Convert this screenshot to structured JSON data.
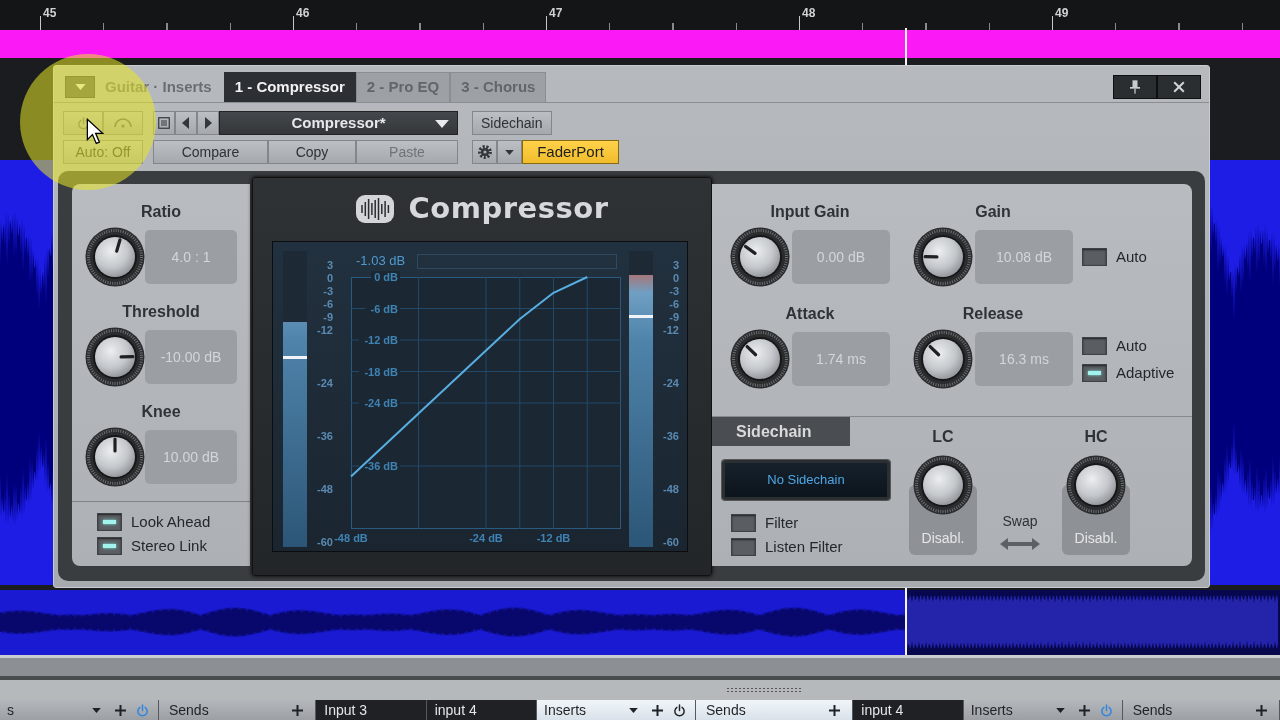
{
  "timeline": {
    "bars": [
      "45",
      "46",
      "47",
      "48",
      "49"
    ]
  },
  "plugin": {
    "title": "Guitar · Inserts",
    "tabs": [
      {
        "label": "1 - Compressor",
        "selected": true
      },
      {
        "label": "2 - Pro EQ",
        "selected": false
      },
      {
        "label": "3 - Chorus",
        "selected": false
      }
    ],
    "preset": "Compressor*",
    "sidechain_button": "Sidechain",
    "automation_button": "Auto: Off",
    "edit_buttons": [
      {
        "label": "Compare",
        "disabled": false
      },
      {
        "label": "Copy",
        "disabled": false
      },
      {
        "label": "Paste",
        "disabled": true
      }
    ],
    "device_button": {
      "label": "FaderPort",
      "active": true
    }
  },
  "compressor": {
    "title": "Compressor",
    "left_knobs": [
      {
        "label": "Ratio",
        "value": "4.0 : 1",
        "level": 0.56
      },
      {
        "label": "Threshold",
        "value": "-10.00 dB",
        "level": 0.83
      },
      {
        "label": "Knee",
        "value": "10.00 dB",
        "level": 0.5
      }
    ],
    "left_options": [
      {
        "label": "Look Ahead",
        "checked": true
      },
      {
        "label": "Stereo Link",
        "checked": true
      }
    ],
    "display": {
      "gain_reduction": "-1.03 dB",
      "input_meter": {
        "scale": [
          "3",
          "0",
          "-3",
          "-6",
          "-9",
          "-12",
          "-24",
          "-36",
          "-48",
          "-60"
        ],
        "level": 0.76,
        "hold": {
          "level": 0.64
        }
      },
      "output_meter": {
        "scale": [
          "3",
          "0",
          "-3",
          "-6",
          "-9",
          "-12",
          "-24",
          "-36",
          "-48",
          "-60"
        ],
        "level": 0.92,
        "hold": {
          "level": 0.78
        }
      },
      "chart_data": {
        "type": "line",
        "x": [
          -48,
          -36,
          -24,
          -18,
          -12,
          -6
        ],
        "values": [
          -38,
          -26,
          -14,
          -8,
          -3,
          0
        ],
        "color": "#58aee0",
        "xlim": [
          -48,
          0
        ],
        "ylim": [
          -48,
          0
        ],
        "xticks": [
          {
            "value": -48,
            "label": "-48 dB"
          },
          {
            "value": -24,
            "label": "-24 dB"
          },
          {
            "value": -12,
            "label": "-12 dB"
          }
        ],
        "yticks": [
          {
            "value": 0,
            "label": "0 dB"
          },
          {
            "value": -6,
            "label": "-6 dB"
          },
          {
            "value": -12,
            "label": "-12 dB"
          },
          {
            "value": -18,
            "label": "-18 dB"
          },
          {
            "value": -24,
            "label": "-24 dB"
          },
          {
            "value": -36,
            "label": "-36 dB"
          }
        ],
        "grid": true
      }
    },
    "right_knobs": [
      {
        "label": "Input Gain",
        "value": "0.00 dB",
        "level": 0.3
      },
      {
        "label": "Gain",
        "value": "10.08 dB",
        "level": 0.17,
        "options": [
          {
            "label": "Auto",
            "checked": false
          }
        ]
      },
      {
        "label": "Attack",
        "value": "1.74 ms",
        "level": 0.33
      },
      {
        "label": "Release",
        "value": "16.3 ms",
        "level": 0.33,
        "options": [
          {
            "label": "Auto",
            "checked": false
          },
          {
            "label": "Adaptive",
            "checked": true
          }
        ]
      }
    ],
    "sidechain": {
      "title": "Sidechain",
      "source": "No Sidechain",
      "options": [
        {
          "label": "Filter",
          "checked": false
        },
        {
          "label": "Listen Filter",
          "checked": false
        }
      ],
      "filters": [
        {
          "label": "LC",
          "value": "Disabl."
        },
        {
          "label": "HC",
          "value": "Disabl."
        }
      ],
      "swap": "Swap"
    }
  },
  "mixer_strip": [
    {
      "kind": "inserts",
      "label": "s",
      "selected": false
    },
    {
      "kind": "sends",
      "label": "Sends",
      "selected": false
    },
    {
      "kind": "input",
      "label": "Input 3",
      "selected": false
    },
    {
      "kind": "input",
      "label": "input 4",
      "selected": false
    },
    {
      "kind": "inserts",
      "label": "Inserts",
      "selected": true
    },
    {
      "kind": "sends",
      "label": "Sends",
      "selected": true
    },
    {
      "kind": "input",
      "label": "input 4",
      "selected": false
    },
    {
      "kind": "inserts",
      "label": "Inserts",
      "selected": false
    },
    {
      "kind": "sends",
      "label": "Sends",
      "selected": false
    }
  ]
}
